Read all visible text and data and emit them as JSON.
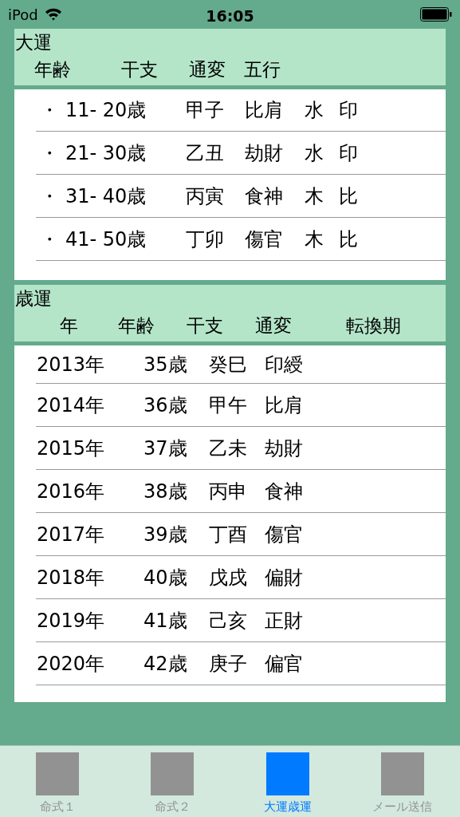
{
  "status_bar": {
    "carrier": "iPod",
    "time": "16:05"
  },
  "daiun": {
    "title": "大運",
    "columns": [
      "年齢",
      "干支",
      "通変",
      "五行"
    ],
    "rows": [
      {
        "cells": [
          "・",
          "11- 20歳",
          "甲子",
          "比肩",
          "水",
          "印"
        ]
      },
      {
        "cells": [
          "・",
          "21- 30歳",
          "乙丑",
          "劫財",
          "水",
          "印"
        ]
      },
      {
        "cells": [
          "・",
          "31- 40歳",
          "丙寅",
          "食神",
          "木",
          "比"
        ]
      },
      {
        "cells": [
          "・",
          "41- 50歳",
          "丁卯",
          "傷官",
          "木",
          "比"
        ]
      }
    ]
  },
  "saiun": {
    "title": "歳運",
    "columns": [
      "年",
      "年齢",
      "干支",
      "通変",
      "転換期"
    ],
    "rows": [
      {
        "cells": [
          "2013年",
          "35歳",
          "癸巳",
          "印綬"
        ]
      },
      {
        "cells": [
          "2014年",
          "36歳",
          "甲午",
          "比肩"
        ]
      },
      {
        "cells": [
          "2015年",
          "37歳",
          "乙未",
          "劫財"
        ]
      },
      {
        "cells": [
          "2016年",
          "38歳",
          "丙申",
          "食神"
        ]
      },
      {
        "cells": [
          "2017年",
          "39歳",
          "丁酉",
          "傷官"
        ]
      },
      {
        "cells": [
          "2018年",
          "40歳",
          "戊戌",
          "偏財"
        ]
      },
      {
        "cells": [
          "2019年",
          "41歳",
          "己亥",
          "正財"
        ]
      },
      {
        "cells": [
          "2020年",
          "42歳",
          "庚子",
          "偏官"
        ]
      }
    ]
  },
  "tabs": [
    {
      "label": "命式１",
      "selected": false
    },
    {
      "label": "命式２",
      "selected": false
    },
    {
      "label": "大運歳運",
      "selected": true
    },
    {
      "label": "メール送信",
      "selected": false
    }
  ]
}
